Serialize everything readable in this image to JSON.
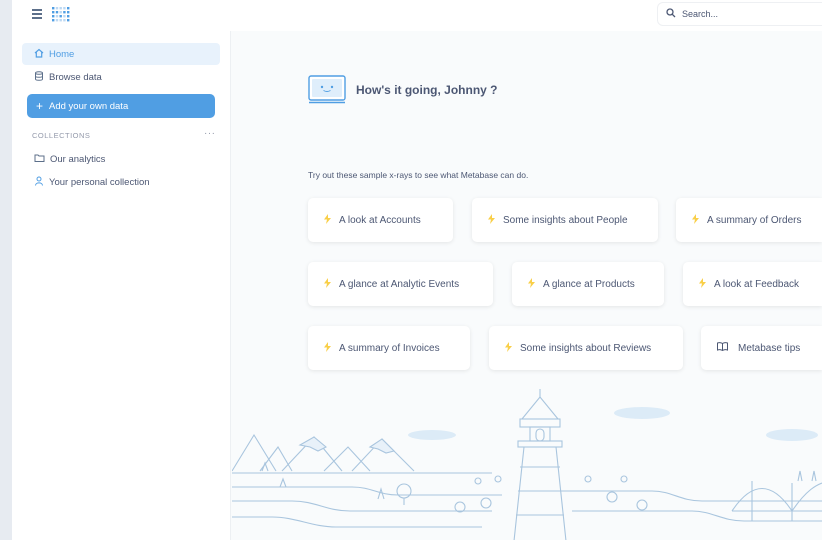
{
  "topbar": {
    "search_placeholder": "Search..."
  },
  "sidebar": {
    "items": [
      {
        "label": "Home",
        "icon": "home-icon",
        "active": true
      },
      {
        "label": "Browse data",
        "icon": "database-icon",
        "active": false
      }
    ],
    "add_data_label": "Add your own data",
    "collections_header": "COLLECTIONS",
    "collections": [
      {
        "label": "Our analytics",
        "icon": "folder-icon"
      },
      {
        "label": "Your personal collection",
        "icon": "person-icon"
      }
    ]
  },
  "main": {
    "greeting": "How's it going, Johnny ?",
    "xray_intro": "Try out these sample x-rays to see what Metabase can do.",
    "xrays": [
      {
        "label": "A look at Accounts"
      },
      {
        "label": "Some insights about People"
      },
      {
        "label": "A summary of Orders"
      },
      {
        "label": "A glance at Analytic Events"
      },
      {
        "label": "A glance at Products"
      },
      {
        "label": "A look at Feedback"
      },
      {
        "label": "A summary of Invoices"
      },
      {
        "label": "Some insights about Reviews"
      }
    ],
    "tips_label": "Metabase tips"
  },
  "colors": {
    "brand": "#509ee3",
    "bolt": "#f9cf48",
    "text": "#4c5773",
    "muted": "#949aab"
  }
}
